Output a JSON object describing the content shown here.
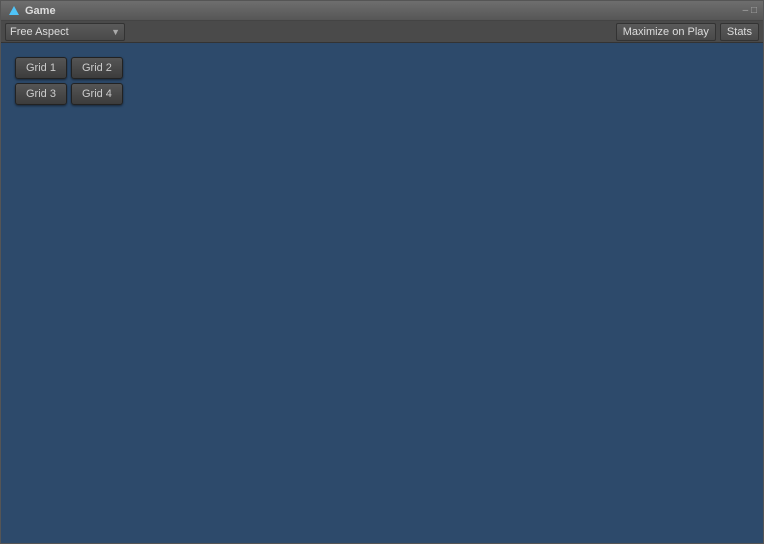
{
  "window": {
    "title": "Game",
    "icon": "game-icon"
  },
  "titlebar": {
    "title": "Game",
    "controls": "– □"
  },
  "toolbar": {
    "aspect_label": "Free Aspect",
    "maximize_label": "Maximize on Play",
    "stats_label": "Stats"
  },
  "grid_buttons": [
    {
      "label": "Grid 1",
      "id": "grid1"
    },
    {
      "label": "Grid 2",
      "id": "grid2"
    },
    {
      "label": "Grid 3",
      "id": "grid3"
    },
    {
      "label": "Grid 4",
      "id": "grid4"
    }
  ]
}
